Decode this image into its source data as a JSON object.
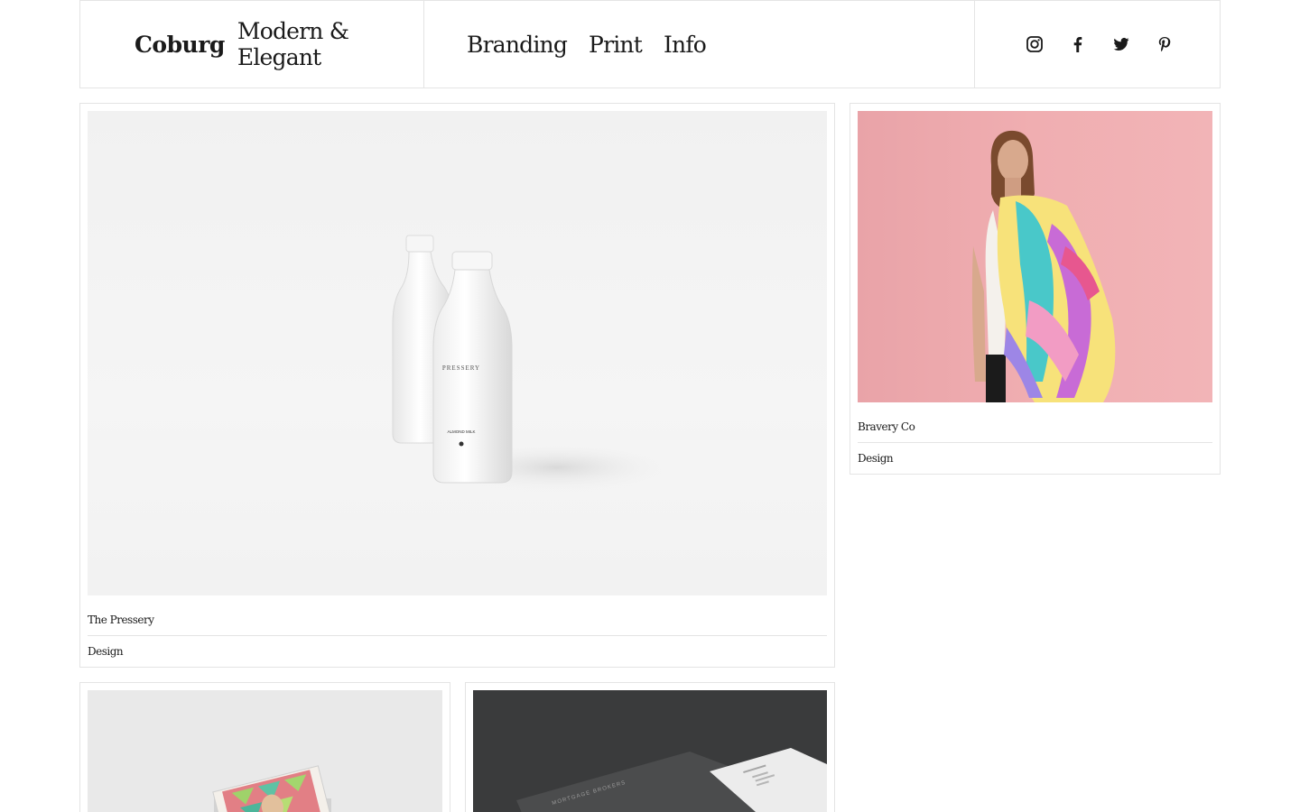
{
  "header": {
    "brand_name": "Coburg",
    "brand_tagline": "Modern & Elegant",
    "nav": [
      "Branding",
      "Print",
      "Info"
    ],
    "social": [
      "instagram-icon",
      "facebook-icon",
      "twitter-icon",
      "pinterest-icon"
    ]
  },
  "projects": [
    {
      "title": "The Pressery",
      "category": "Design",
      "image": "two white almond milk bottles labeled PRESSERY"
    },
    {
      "title": "Bravery Co",
      "category": "Design",
      "image": "woman wearing colorful scarf against pink background"
    },
    {
      "title": "",
      "category": "",
      "image": "stack of magazines with geometric cover"
    },
    {
      "title": "",
      "category": "",
      "image": "dark stationery set labeled MORTGAGE BROKERS"
    }
  ],
  "image_text": {
    "bottle_brand": "PRESSERY",
    "bottle_product": "ALMOND MILK",
    "stationery_brand": "MORTGAGE BROKERS"
  },
  "colors": {
    "border": "#e4e4e4",
    "text": "#1a1a1a",
    "pink_background": "#f0aeb1",
    "dark_background": "#3a3b3c"
  }
}
